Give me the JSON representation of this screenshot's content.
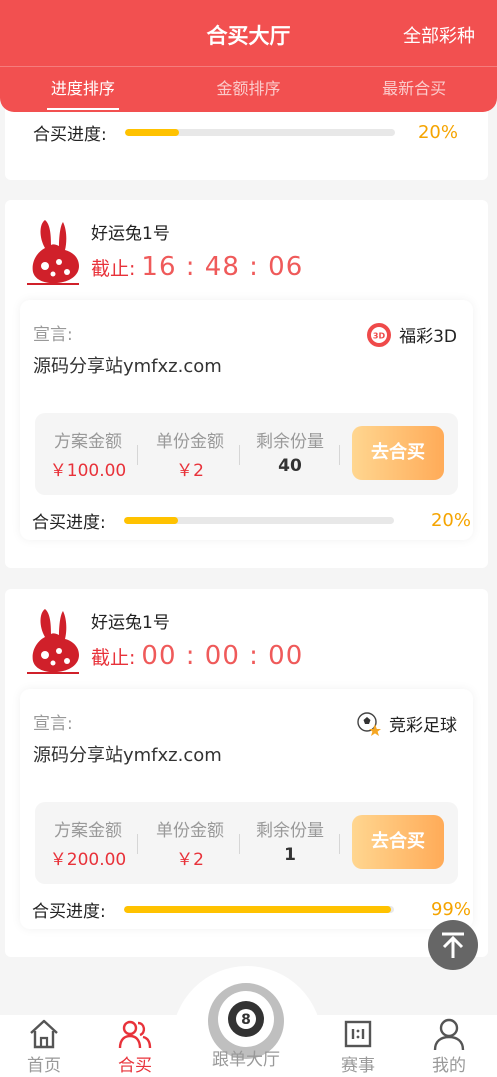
{
  "header": {
    "title": "合买大厅",
    "all_lottery": "全部彩种",
    "tabs": [
      {
        "label": "进度排序",
        "active": true
      },
      {
        "label": "金额排序",
        "active": false
      },
      {
        "label": "最新合买",
        "active": false
      }
    ]
  },
  "partial_card": {
    "progress_label": "合买进度:",
    "progress_pct": "20%",
    "progress_value": 0.2
  },
  "plans": [
    {
      "owner_icon": "rabbit-icon",
      "owner_name": "好运兔1号",
      "deadline_label": "截止:",
      "deadline_time": "16 : 48 : 06",
      "declaration_label": "宣言:",
      "lottery_icon": "fucai-3d-icon",
      "lottery_name": "福彩3D",
      "declaration": "源码分享站ymfxz.com",
      "total_label": "方案金额",
      "total_value": "￥100.00",
      "unit_label": "单份金额",
      "unit_value": "￥2",
      "remain_label": "剩余份量",
      "remain_value": "40",
      "buy_label": "去合买",
      "progress_label": "合买进度:",
      "progress_pct": "20%",
      "progress_value": 0.2
    },
    {
      "owner_icon": "rabbit-icon",
      "owner_name": "好运兔1号",
      "deadline_label": "截止:",
      "deadline_time": "00 : 00 : 00",
      "declaration_label": "宣言:",
      "lottery_icon": "football-icon",
      "lottery_name": "竞彩足球",
      "declaration": "源码分享站ymfxz.com",
      "total_label": "方案金额",
      "total_value": "￥200.00",
      "unit_label": "单份金额",
      "unit_value": "￥2",
      "remain_label": "剩余份量",
      "remain_value": "1",
      "buy_label": "去合买",
      "progress_label": "合买进度:",
      "progress_pct": "99%",
      "progress_value": 0.99
    }
  ],
  "bottom_nav": [
    {
      "label": "首页",
      "icon": "home-icon",
      "active": false
    },
    {
      "label": "合买",
      "icon": "group-icon",
      "active": true
    },
    {
      "label": "跟单大厅",
      "icon": "billiard-ball-icon",
      "active": false
    },
    {
      "label": "赛事",
      "icon": "scoreboard-icon",
      "active": false
    },
    {
      "label": "我的",
      "icon": "user-icon",
      "active": false
    }
  ],
  "colors": {
    "brand": "#f25050",
    "price": "#e8323a",
    "progress": "#ffc200",
    "button": "#ffab58"
  }
}
